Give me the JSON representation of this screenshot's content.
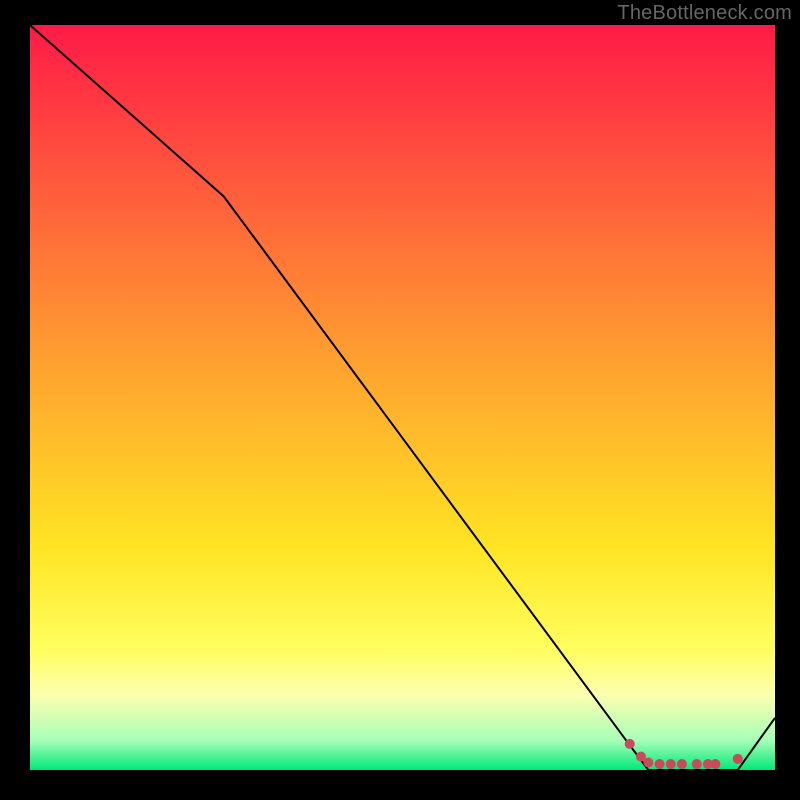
{
  "watermark": "TheBottleneck.com",
  "chart_data": {
    "type": "line",
    "title": "",
    "xlabel": "",
    "ylabel": "",
    "xlim": [
      0,
      100
    ],
    "ylim": [
      0,
      100
    ],
    "grid": false,
    "annotations": [],
    "background_gradient": {
      "type": "vertical",
      "stops": [
        {
          "pos": 0,
          "color": "#ff1a47"
        },
        {
          "pos": 0.45,
          "color": "#ffa030"
        },
        {
          "pos": 0.7,
          "color": "#ffe423"
        },
        {
          "pos": 0.84,
          "color": "#ffff60"
        },
        {
          "pos": 0.9,
          "color": "#fbffb0"
        },
        {
          "pos": 0.96,
          "color": "#a8ffb8"
        },
        {
          "pos": 1.0,
          "color": "#00e878"
        }
      ]
    },
    "series": [
      {
        "name": "bottleneck-curve",
        "color": "#000000",
        "width": 2,
        "x": [
          0,
          26,
          80,
          83,
          92,
          95,
          100
        ],
        "y": [
          100,
          77,
          4,
          0,
          0,
          0,
          7
        ]
      }
    ],
    "markers": [
      {
        "name": "flat-region-dots",
        "color": "#c94a5a",
        "radius": 5,
        "points": [
          {
            "x": 80.5,
            "y": 3.5
          },
          {
            "x": 82.0,
            "y": 1.8
          },
          {
            "x": 83.0,
            "y": 1.0
          },
          {
            "x": 84.5,
            "y": 0.8
          },
          {
            "x": 86.0,
            "y": 0.8
          },
          {
            "x": 87.5,
            "y": 0.8
          },
          {
            "x": 89.5,
            "y": 0.8
          },
          {
            "x": 91.0,
            "y": 0.8
          },
          {
            "x": 92.0,
            "y": 0.8
          },
          {
            "x": 95.0,
            "y": 1.5
          }
        ]
      }
    ]
  }
}
